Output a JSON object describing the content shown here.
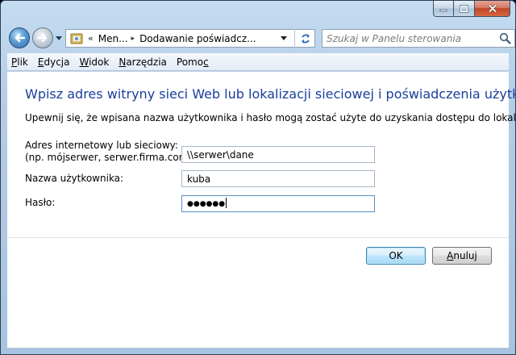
{
  "window": {
    "minimize_icon": "minimize-icon",
    "maximize_icon": "maximize-icon",
    "close_icon": "close-icon"
  },
  "navbar": {
    "back_icon": "back-arrow-icon",
    "forward_icon": "forward-arrow-icon",
    "breadcrumb_prefix": "«",
    "breadcrumb_1": "Men...",
    "breadcrumb_2": "Dodawanie poświadcz...",
    "refresh_icon": "refresh-icon",
    "search_placeholder": "Szukaj w Panelu sterowania",
    "search_icon": "magnifier-icon"
  },
  "menu": {
    "items": [
      {
        "prefix": "",
        "u": "P",
        "rest": "lik"
      },
      {
        "prefix": "",
        "u": "E",
        "rest": "dycja"
      },
      {
        "prefix": "",
        "u": "W",
        "rest": "idok"
      },
      {
        "prefix": "",
        "u": "N",
        "rest": "arzędzia"
      },
      {
        "prefix": "Pomo",
        "u": "c",
        "rest": ""
      }
    ]
  },
  "content": {
    "heading": "Wpisz adres witryny sieci Web lub lokalizacji sieciowej i poświadczenia użytkownika",
    "intro": "Upewnij się, że wpisana nazwa użytkownika i hasło mogą zostać użyte do uzyskania dostępu do lokalizacji.",
    "address_label_line1": "Adres internetowy lub sieciowy:",
    "address_label_line2": "(np. mójserwer, serwer.firma.com):",
    "address_value": "\\\\serwer\\dane",
    "username_label": "Nazwa użytkownika:",
    "username_value": "kuba",
    "password_label": "Hasło:",
    "password_value": "●●●●●●"
  },
  "buttons": {
    "ok": "OK",
    "cancel_u": "A",
    "cancel_rest": "nuluj"
  },
  "colors": {
    "heading": "#1a3e9c",
    "default_button_border": "#3c7fb1"
  }
}
